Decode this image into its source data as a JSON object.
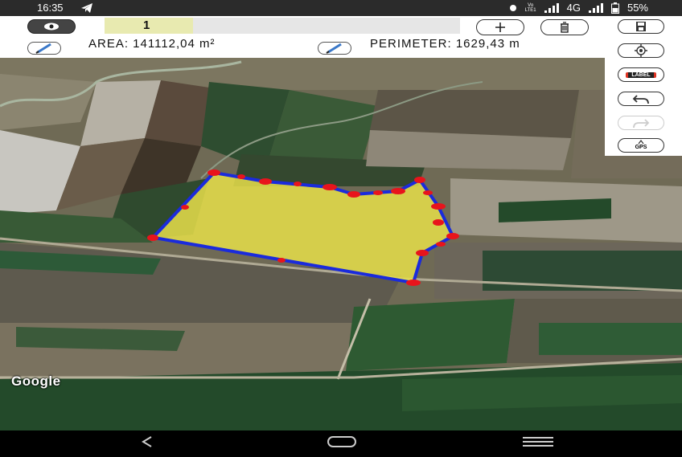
{
  "status_bar": {
    "time": "16:35",
    "network_label": "4G",
    "volte_top": "Vo",
    "volte_bottom": "LTE1",
    "battery": "55%",
    "icons": [
      "telegram-icon",
      "alarm-icon",
      "signal-icon",
      "battery-icon"
    ]
  },
  "toolbar": {
    "point_count": "1",
    "area_text": "AREA: 141112,04 m²",
    "perimeter_text": "PERIMETER: 1629,43 m",
    "icons": [
      "eye-icon",
      "plus-icon",
      "trash-icon",
      "pencil-icon"
    ]
  },
  "side_panel": {
    "label_button": "LABEL",
    "gps_button": "GPS",
    "icons": [
      "save-icon",
      "locate-icon",
      "label-icon",
      "undo-icon",
      "redo-icon",
      "gps-icon"
    ]
  },
  "map": {
    "attribution": "Google",
    "polygon_fill": "#e8df4a",
    "polygon_stroke": "#1a2bdc",
    "vertex_color": "#e8141c"
  },
  "colors": {
    "statusbar": "#2b2b2b",
    "toolbar": "#ffffff"
  }
}
